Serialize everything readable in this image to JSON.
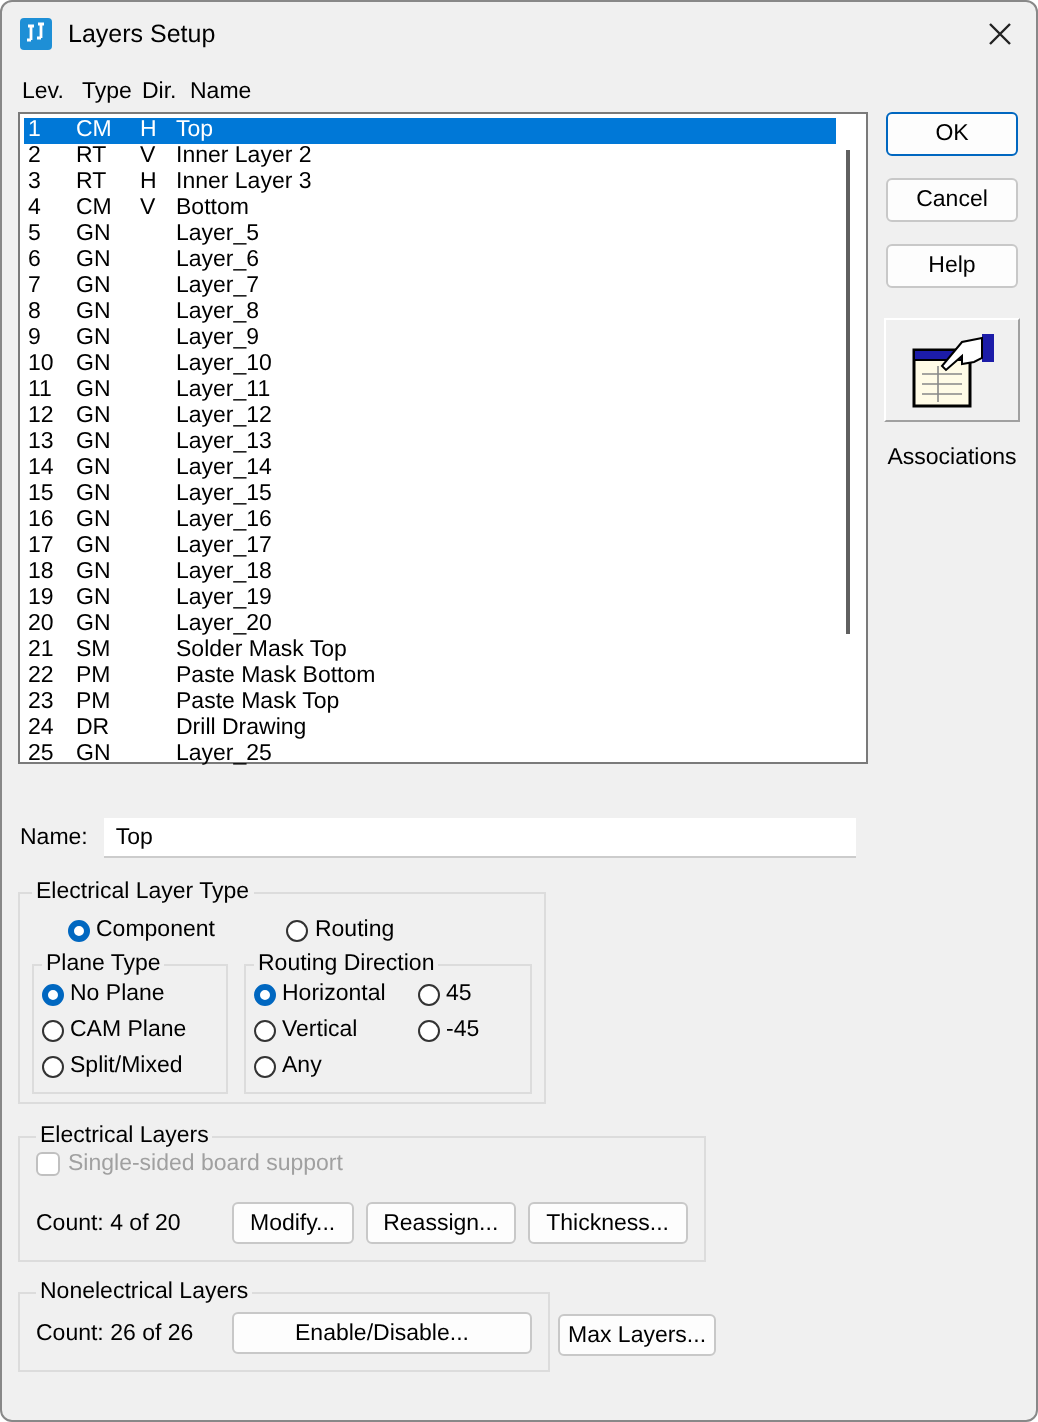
{
  "window": {
    "title": "Layers Setup"
  },
  "list": {
    "columns": [
      "Lev.",
      "Type",
      "Dir.",
      "Name"
    ],
    "rows": [
      {
        "lev": "1",
        "type": "CM",
        "dir": "H",
        "name": "Top",
        "selected": true
      },
      {
        "lev": "2",
        "type": "RT",
        "dir": "V",
        "name": "Inner Layer 2",
        "selected": false
      },
      {
        "lev": "3",
        "type": "RT",
        "dir": "H",
        "name": "Inner Layer 3",
        "selected": false
      },
      {
        "lev": "4",
        "type": "CM",
        "dir": "V",
        "name": "Bottom",
        "selected": false
      },
      {
        "lev": "5",
        "type": "GN",
        "name": "Layer_5",
        "selected": false
      },
      {
        "lev": "6",
        "type": "GN",
        "name": "Layer_6",
        "selected": false
      },
      {
        "lev": "7",
        "type": "GN",
        "name": "Layer_7",
        "selected": false
      },
      {
        "lev": "8",
        "type": "GN",
        "name": "Layer_8",
        "selected": false
      },
      {
        "lev": "9",
        "type": "GN",
        "name": "Layer_9",
        "selected": false
      },
      {
        "lev": "10",
        "type": "GN",
        "name": "Layer_10",
        "selected": false
      },
      {
        "lev": "11",
        "type": "GN",
        "name": "Layer_11",
        "selected": false
      },
      {
        "lev": "12",
        "type": "GN",
        "name": "Layer_12",
        "selected": false
      },
      {
        "lev": "13",
        "type": "GN",
        "name": "Layer_13",
        "selected": false
      },
      {
        "lev": "14",
        "type": "GN",
        "name": "Layer_14",
        "selected": false
      },
      {
        "lev": "15",
        "type": "GN",
        "name": "Layer_15",
        "selected": false
      },
      {
        "lev": "16",
        "type": "GN",
        "name": "Layer_16",
        "selected": false
      },
      {
        "lev": "17",
        "type": "GN",
        "name": "Layer_17",
        "selected": false
      },
      {
        "lev": "18",
        "type": "GN",
        "name": "Layer_18",
        "selected": false
      },
      {
        "lev": "19",
        "type": "GN",
        "name": "Layer_19",
        "selected": false
      },
      {
        "lev": "20",
        "type": "GN",
        "name": "Layer_20",
        "selected": false
      },
      {
        "lev": "21",
        "type": "SM",
        "name": "Solder Mask Top",
        "selected": false
      },
      {
        "lev": "22",
        "type": "PM",
        "name": "Paste Mask Bottom",
        "selected": false
      },
      {
        "lev": "23",
        "type": "PM",
        "name": "Paste Mask Top",
        "selected": false
      },
      {
        "lev": "24",
        "type": "DR",
        "name": "Drill Drawing",
        "selected": false
      },
      {
        "lev": "25",
        "type": "GN",
        "name": "Layer_25",
        "selected": false
      }
    ]
  },
  "side_buttons": [
    {
      "label": "OK",
      "kind": "default"
    },
    {
      "label": "Cancel",
      "kind": "normal"
    },
    {
      "label": "Help",
      "kind": "normal"
    }
  ],
  "associations": {
    "label": "Associations"
  },
  "name_field": {
    "label": "Name:",
    "value": "Top"
  },
  "electrical_layer_type": {
    "title": "Electrical  Layer Type",
    "options": [
      {
        "label": "Component",
        "selected": true
      },
      {
        "label": "Routing",
        "selected": false
      }
    ]
  },
  "plane_type": {
    "title": "Plane Type",
    "options": [
      {
        "label": "No Plane",
        "selected": true
      },
      {
        "label": "CAM Plane",
        "selected": false
      },
      {
        "label": "Split/Mixed",
        "selected": false
      }
    ]
  },
  "routing_direction": {
    "title": "Routing Direction",
    "options": [
      {
        "label": "Horizontal",
        "selected": true
      },
      {
        "label": "45",
        "selected": false
      },
      {
        "label": "Vertical",
        "selected": false
      },
      {
        "label": "-45",
        "selected": false
      },
      {
        "label": "Any",
        "selected": false
      }
    ]
  },
  "electrical_layers": {
    "title": "Electrical Layers",
    "single_sided": {
      "label": "Single-sided board support",
      "checked": false,
      "disabled": true
    },
    "count": "Count:  4 of 20",
    "buttons": [
      "Modify...",
      "Reassign...",
      "Thickness..."
    ]
  },
  "nonelectrical_layers": {
    "title": "Nonelectrical Layers",
    "count": "Count: 26 of 26",
    "buttons": [
      "Enable/Disable..."
    ]
  },
  "max_layers_button": "Max Layers..."
}
